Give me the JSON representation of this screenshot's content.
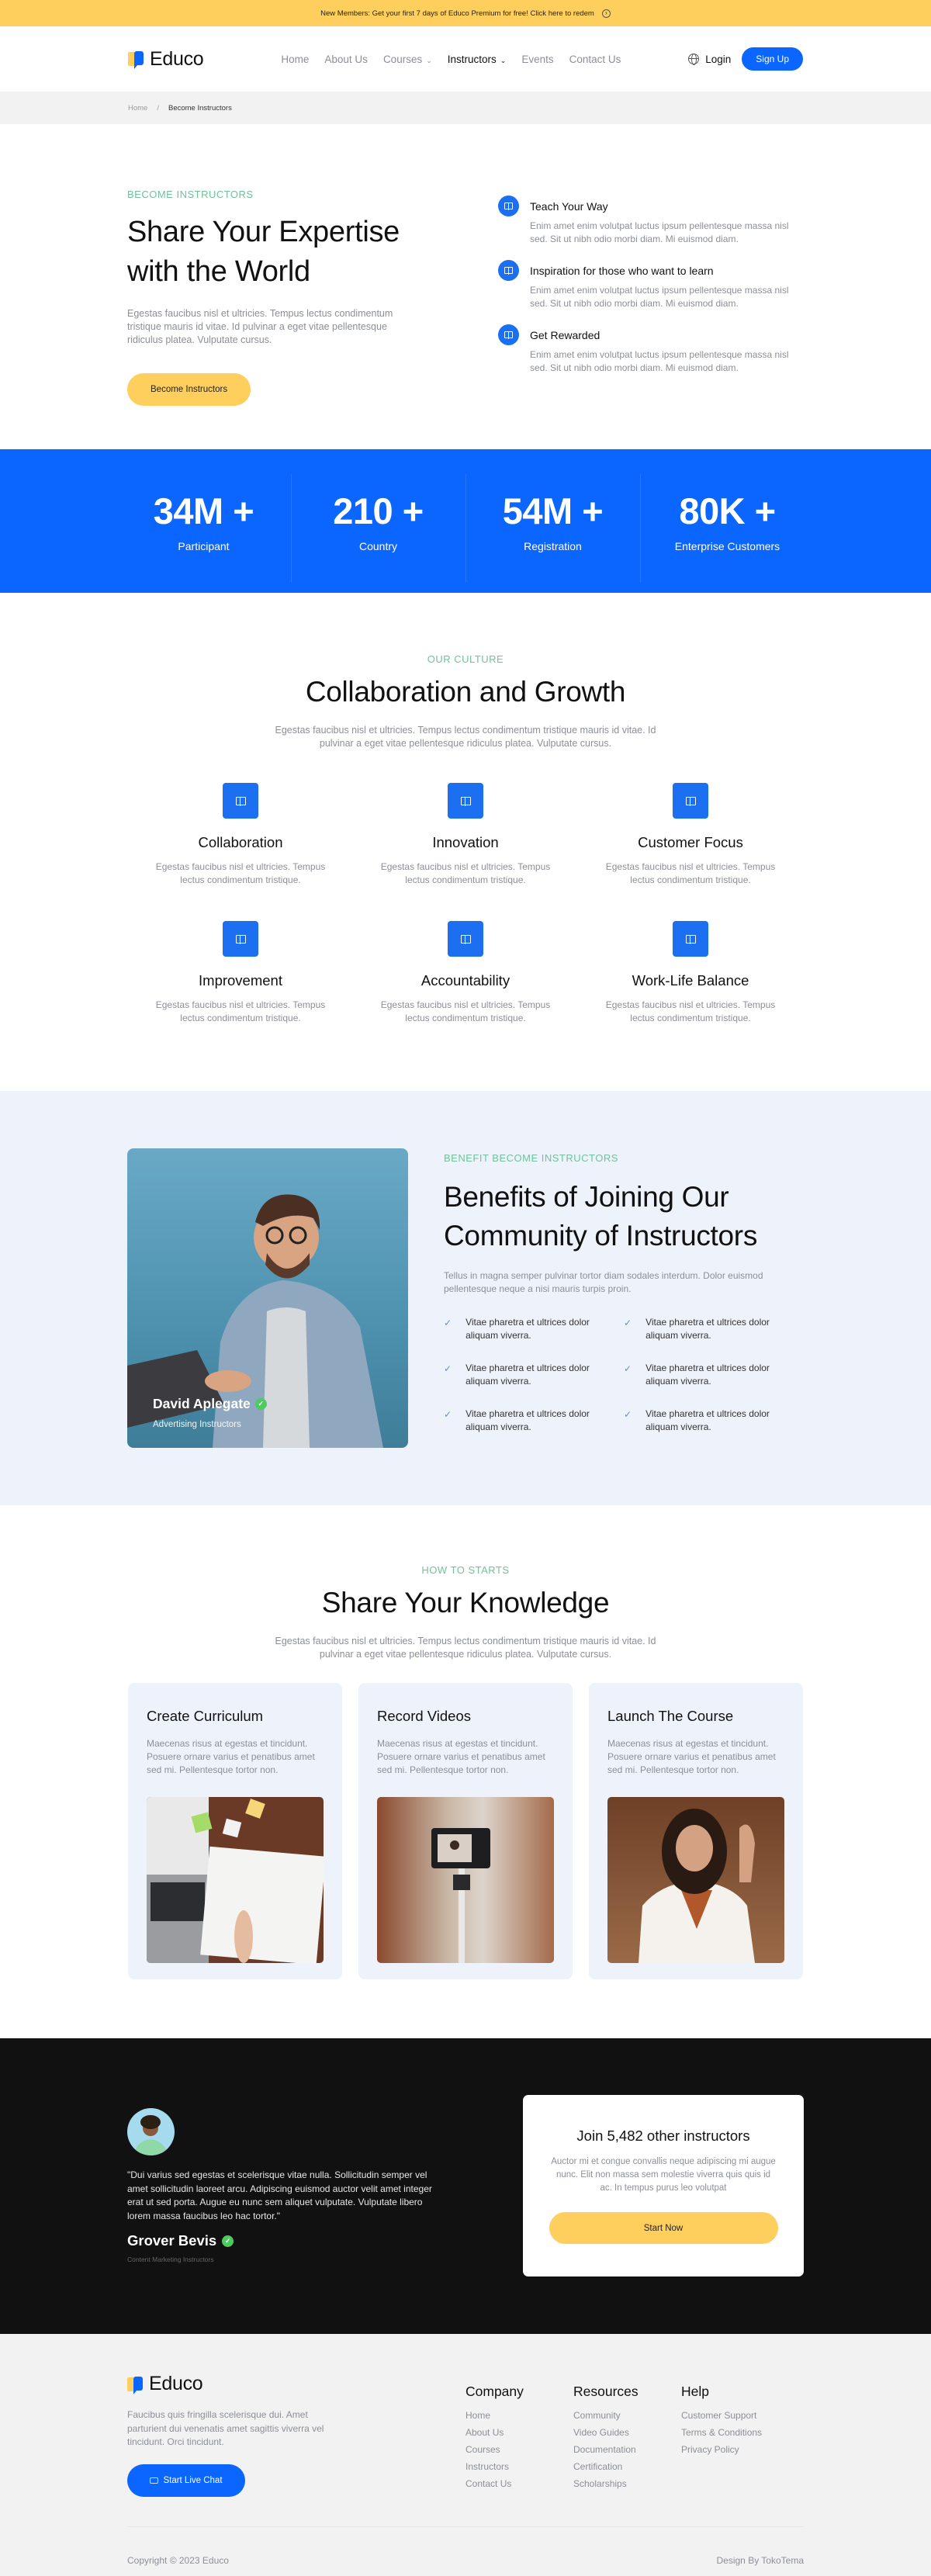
{
  "promo": {
    "text": "New Members: Get your first 7 days of Educo Premium for free! Click here to redem",
    "icon": "arrow-circle-icon"
  },
  "header": {
    "brand": "Educo",
    "nav": [
      {
        "label": "Home",
        "dropdown": false,
        "active": false
      },
      {
        "label": "About Us",
        "dropdown": false,
        "active": false
      },
      {
        "label": "Courses",
        "dropdown": true,
        "active": false
      },
      {
        "label": "Instructors",
        "dropdown": true,
        "active": true
      },
      {
        "label": "Events",
        "dropdown": false,
        "active": false
      },
      {
        "label": "Contact Us",
        "dropdown": false,
        "active": false
      }
    ],
    "login_label": "Login",
    "signup_label": "Sign Up"
  },
  "breadcrumb": {
    "items": [
      "Home",
      "Become Instructors"
    ],
    "separator": "/"
  },
  "hero": {
    "eyebrow": "BECOME INSTRUCTORS",
    "title_line1": "Share Your Expertise",
    "title_line2": "with the World",
    "description": "Egestas faucibus nisl et ultricies. Tempus lectus condimentum tristique mauris id vitae. Id pulvinar a eget vitae pellentesque ridiculus platea. Vulputate cursus.",
    "cta_label": "Become Instructors",
    "features": [
      {
        "title": "Teach Your Way",
        "text": "Enim amet enim volutpat luctus ipsum pellentesque massa nisl sed. Sit ut nibh odio morbi diam. Mi euismod diam."
      },
      {
        "title": "Inspiration for those who want to learn",
        "text": "Enim amet enim volutpat luctus ipsum pellentesque massa nisl sed. Sit ut nibh odio morbi diam. Mi euismod diam."
      },
      {
        "title": "Get Rewarded",
        "text": "Enim amet enim volutpat luctus ipsum pellentesque massa nisl sed. Sit ut nibh odio morbi diam. Mi euismod diam."
      }
    ]
  },
  "stats": [
    {
      "value": "34M +",
      "label": "Participant"
    },
    {
      "value": "210 +",
      "label": "Country"
    },
    {
      "value": "54M +",
      "label": "Registration"
    },
    {
      "value": "80K +",
      "label": "Enterprise Customers"
    }
  ],
  "culture": {
    "eyebrow": "OUR CULTURE",
    "title": "Collaboration and Growth",
    "description": "Egestas faucibus nisl et ultricies. Tempus lectus condimentum tristique mauris id vitae. Id pulvinar a eget vitae pellentesque ridiculus platea. Vulputate cursus.",
    "items": [
      {
        "title": "Collaboration",
        "text": "Egestas faucibus nisl et ultricies. Tempus lectus condimentum tristique."
      },
      {
        "title": "Innovation",
        "text": "Egestas faucibus nisl et ultricies. Tempus lectus condimentum tristique."
      },
      {
        "title": "Customer Focus",
        "text": "Egestas faucibus nisl et ultricies. Tempus lectus condimentum tristique."
      },
      {
        "title": "Improvement",
        "text": "Egestas faucibus nisl et ultricies. Tempus lectus condimentum tristique."
      },
      {
        "title": "Accountability",
        "text": "Egestas faucibus nisl et ultricies. Tempus lectus condimentum tristique."
      },
      {
        "title": "Work-Life Balance",
        "text": "Egestas faucibus nisl et ultricies. Tempus lectus condimentum tristique."
      }
    ]
  },
  "benefits": {
    "eyebrow": "BENEFIT BECOME INSTRUCTORS",
    "title_line1": "Benefits of Joining Our",
    "title_line2": "Community of Instructors",
    "description": "Tellus in magna semper pulvinar tortor diam sodales interdum. Dolor euismod pellentesque neque a nisi mauris turpis proin.",
    "instructor_name": "David Aplegate",
    "instructor_role": "Advertising Instructors",
    "checks": [
      "Vitae pharetra et ultrices dolor aliquam viverra.",
      "Vitae pharetra et ultrices dolor aliquam viverra.",
      "Vitae pharetra et ultrices dolor aliquam viverra.",
      "Vitae pharetra et ultrices dolor aliquam viverra.",
      "Vitae pharetra et ultrices dolor aliquam viverra.",
      "Vitae pharetra et ultrices dolor aliquam viverra."
    ]
  },
  "knowledge": {
    "eyebrow": "HOW TO STARTS",
    "title": "Share Your Knowledge",
    "description": "Egestas faucibus nisl et ultricies. Tempus lectus condimentum tristique mauris id vitae. Id pulvinar a eget vitae pellentesque ridiculus platea. Vulputate cursus.",
    "steps": [
      {
        "title": "Create Curriculum",
        "text": "Maecenas risus at egestas et tincidunt. Posuere ornare varius et penatibus amet sed mi. Pellentesque tortor non.",
        "image": "notebook-laptop-photo"
      },
      {
        "title": "Record Videos",
        "text": "Maecenas risus at egestas et tincidunt. Posuere ornare varius et penatibus amet sed mi. Pellentesque tortor non.",
        "image": "camera-tripod-photo"
      },
      {
        "title": "Launch The Course",
        "text": "Maecenas risus at egestas et tincidunt. Posuere ornare varius et penatibus amet sed mi. Pellentesque tortor non.",
        "image": "waving-woman-photo"
      }
    ]
  },
  "testimonial": {
    "quote": "\"Dui varius sed egestas et scelerisque vitae nulla. Sollicitudin semper vel amet sollicitudin laoreet arcu. Adipiscing euismod auctor velit amet integer erat ut sed porta. Augue eu nunc sem aliquet vulputate. Vulputate libero lorem massa faucibus leo hac tortor.\"",
    "name": "Grover Bevis",
    "role": "Content Marketing Instructors"
  },
  "join": {
    "title": "Join 5,482 other instructors",
    "description": "Auctor mi et congue convallis neque adipiscing mi augue nunc. Elit non massa sem molestie viverra quis quis id ac. In tempus purus leo volutpat",
    "cta_label": "Start Now"
  },
  "footer": {
    "brand": "Educo",
    "description": "Faucibus quis fringilla scelerisque dui. Amet parturient dui venenatis amet sagittis viverra vel tincidunt. Orci tincidunt.",
    "chat_label": "Start Live Chat",
    "columns": [
      {
        "title": "Company",
        "links": [
          "Home",
          "About Us",
          "Courses",
          "Instructors",
          "Contact Us"
        ]
      },
      {
        "title": "Resources",
        "links": [
          "Community",
          "Video Guides",
          "Documentation",
          "Certification",
          "Scholarships"
        ]
      },
      {
        "title": "Help",
        "links": [
          "Customer Support",
          "Terms & Conditions",
          "Privacy Policy"
        ]
      }
    ],
    "copyright": "Copyright © 2023 Educo",
    "credit": "Design By TokoTema"
  },
  "colors": {
    "primary": "#0b66ff",
    "accent_yellow": "#fecf5c",
    "eyebrow_green": "#6fc29c",
    "icon_blue": "#1d6ff2",
    "benefits_bg": "#eef2fa",
    "dark_bg": "#111111",
    "footer_bg": "#f2f2f2",
    "verified_green": "#4ccc5e"
  }
}
